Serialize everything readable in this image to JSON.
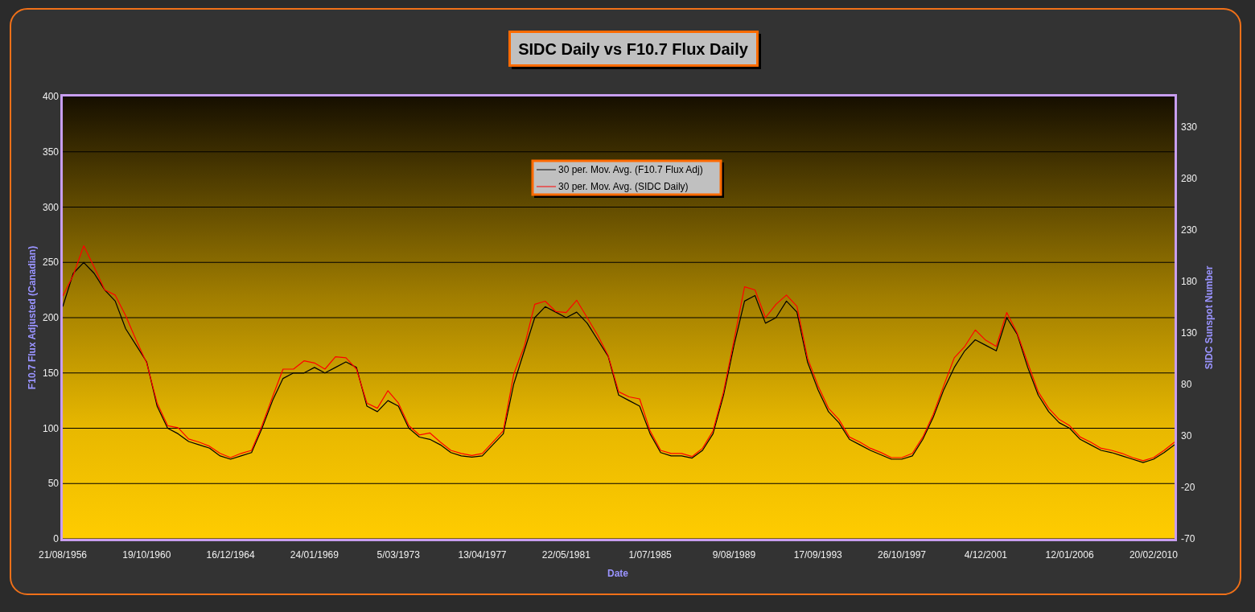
{
  "chart": {
    "title": "SIDC Daily vs F10.7 Flux Daily",
    "chart_data": {
      "type": "line",
      "xlabel": "Date",
      "ylabel": "F10.7 Flux Adjusted (Canadian)",
      "y2label": "SIDC Sunspot Number",
      "grid": true,
      "legend": "top",
      "ylim": [
        0,
        400
      ],
      "y2lim": [
        -70,
        360
      ],
      "categories": [
        "21/08/1956",
        null,
        null,
        null,
        null,
        null,
        null,
        null,
        "19/10/1960",
        null,
        null,
        null,
        null,
        null,
        null,
        null,
        "16/12/1964",
        null,
        null,
        null,
        null,
        null,
        null,
        null,
        "24/01/1969",
        null,
        null,
        null,
        null,
        null,
        null,
        null,
        "5/03/1973",
        null,
        null,
        null,
        null,
        null,
        null,
        null,
        "13/04/1977",
        null,
        null,
        null,
        null,
        null,
        null,
        null,
        "22/05/1981",
        null,
        null,
        null,
        null,
        null,
        null,
        null,
        "1/07/1985",
        null,
        null,
        null,
        null,
        null,
        null,
        null,
        "9/08/1989",
        null,
        null,
        null,
        null,
        null,
        null,
        null,
        "17/09/1993",
        null,
        null,
        null,
        null,
        null,
        null,
        null,
        "26/10/1997",
        null,
        null,
        null,
        null,
        null,
        null,
        null,
        "4/12/2001",
        null,
        null,
        null,
        null,
        null,
        null,
        null,
        "12/01/2006",
        null,
        null,
        null,
        null,
        null,
        null,
        null,
        "20/02/2010",
        null,
        null
      ],
      "yticks": [
        {
          "value": 0,
          "label": "0"
        },
        {
          "value": 50,
          "label": "50"
        },
        {
          "value": 100,
          "label": "100"
        },
        {
          "value": 150,
          "label": "150"
        },
        {
          "value": 200,
          "label": "200"
        },
        {
          "value": 250,
          "label": "250"
        },
        {
          "value": 300,
          "label": "300"
        },
        {
          "value": 350,
          "label": "350"
        },
        {
          "value": 400,
          "label": "400"
        }
      ],
      "y2ticks": [
        {
          "value": -70,
          "label": "-70"
        },
        {
          "value": -20,
          "label": "-20"
        },
        {
          "value": 30,
          "label": "30"
        },
        {
          "value": 80,
          "label": "80"
        },
        {
          "value": 130,
          "label": "130"
        },
        {
          "value": 180,
          "label": "180"
        },
        {
          "value": 230,
          "label": "230"
        },
        {
          "value": 280,
          "label": "280"
        },
        {
          "value": 330,
          "label": "330"
        }
      ],
      "series": [
        {
          "name": "30 per. Mov. Avg. (F10.7 Flux Adj)",
          "color": "#000000",
          "values": [
            210,
            240,
            250,
            240,
            225,
            215,
            190,
            175,
            160,
            120,
            100,
            95,
            88,
            85,
            82,
            75,
            72,
            75,
            78,
            100,
            125,
            145,
            150,
            150,
            155,
            150,
            155,
            160,
            155,
            120,
            115,
            125,
            120,
            100,
            92,
            90,
            85,
            78,
            75,
            74,
            75,
            85,
            95,
            140,
            170,
            200,
            210,
            205,
            200,
            205,
            195,
            180,
            165,
            130,
            125,
            120,
            95,
            78,
            75,
            75,
            73,
            80,
            95,
            130,
            175,
            215,
            220,
            195,
            200,
            215,
            205,
            160,
            135,
            115,
            105,
            90,
            85,
            80,
            76,
            72,
            72,
            75,
            90,
            110,
            135,
            155,
            170,
            180,
            175,
            170,
            200,
            185,
            155,
            130,
            115,
            105,
            100,
            90,
            85,
            80,
            78,
            75,
            72,
            69,
            72,
            78,
            85
          ]
        },
        {
          "name": "30 per. Mov. Avg. (SIDC Daily)",
          "color": "#ff0000",
          "axis": "y2",
          "values": [
            166,
            186,
            215,
            194,
            172,
            167,
            147,
            123,
            101,
            62,
            40,
            38,
            27,
            24,
            20,
            13,
            9,
            13,
            16,
            40,
            68,
            95,
            95,
            103,
            101,
            95,
            107,
            106,
            95,
            62,
            57,
            74,
            62,
            40,
            31,
            33,
            24,
            16,
            13,
            11,
            13,
            24,
            35,
            90,
            117,
            158,
            161,
            151,
            150,
            162,
            145,
            128,
            108,
            73,
            68,
            66,
            35,
            16,
            13,
            13,
            10,
            18,
            35,
            73,
            123,
            175,
            172,
            145,
            158,
            167,
            156,
            106,
            79,
            57,
            46,
            29,
            24,
            18,
            14,
            9,
            9,
            13,
            29,
            51,
            79,
            106,
            117,
            133,
            123,
            117,
            150,
            130,
            101,
            73,
            57,
            46,
            40,
            29,
            24,
            18,
            16,
            13,
            9,
            6,
            9,
            16,
            24
          ]
        }
      ]
    }
  }
}
